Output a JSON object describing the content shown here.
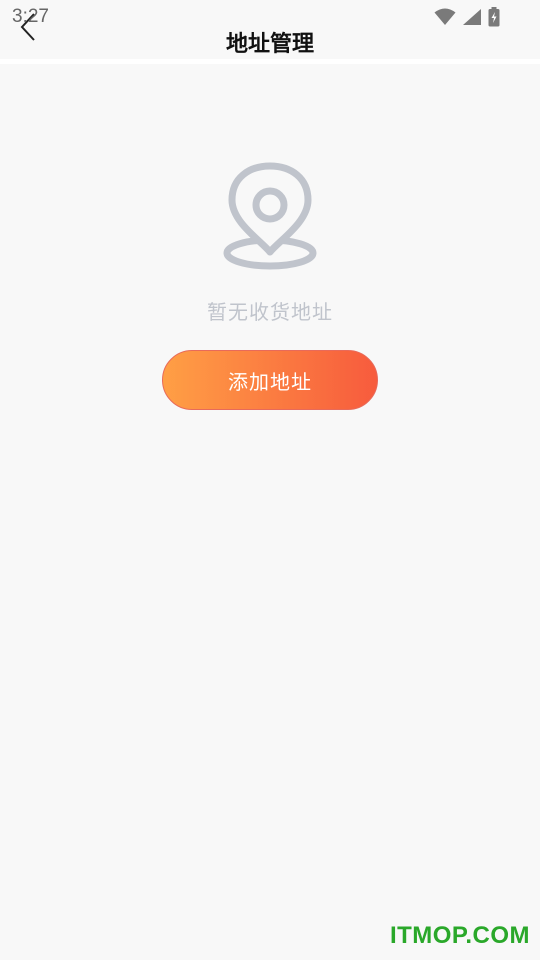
{
  "status_bar": {
    "time": "3:27",
    "icons": [
      "wifi-icon",
      "cellular-signal-icon",
      "battery-charging-icon"
    ]
  },
  "header": {
    "title": "地址管理",
    "back_icon": "chevron-left-icon"
  },
  "empty_state": {
    "icon": "location-pin-icon",
    "message": "暂无收货地址"
  },
  "actions": {
    "add_address_label": "添加地址"
  },
  "watermark": {
    "text": "ITMOP.COM"
  },
  "colors": {
    "background": "#f8f8f8",
    "icon_gray": "#c0c4cc",
    "button_gradient_start": "#ff9f45",
    "button_gradient_end": "#f75b3d",
    "watermark_green": "#2aa82a"
  }
}
